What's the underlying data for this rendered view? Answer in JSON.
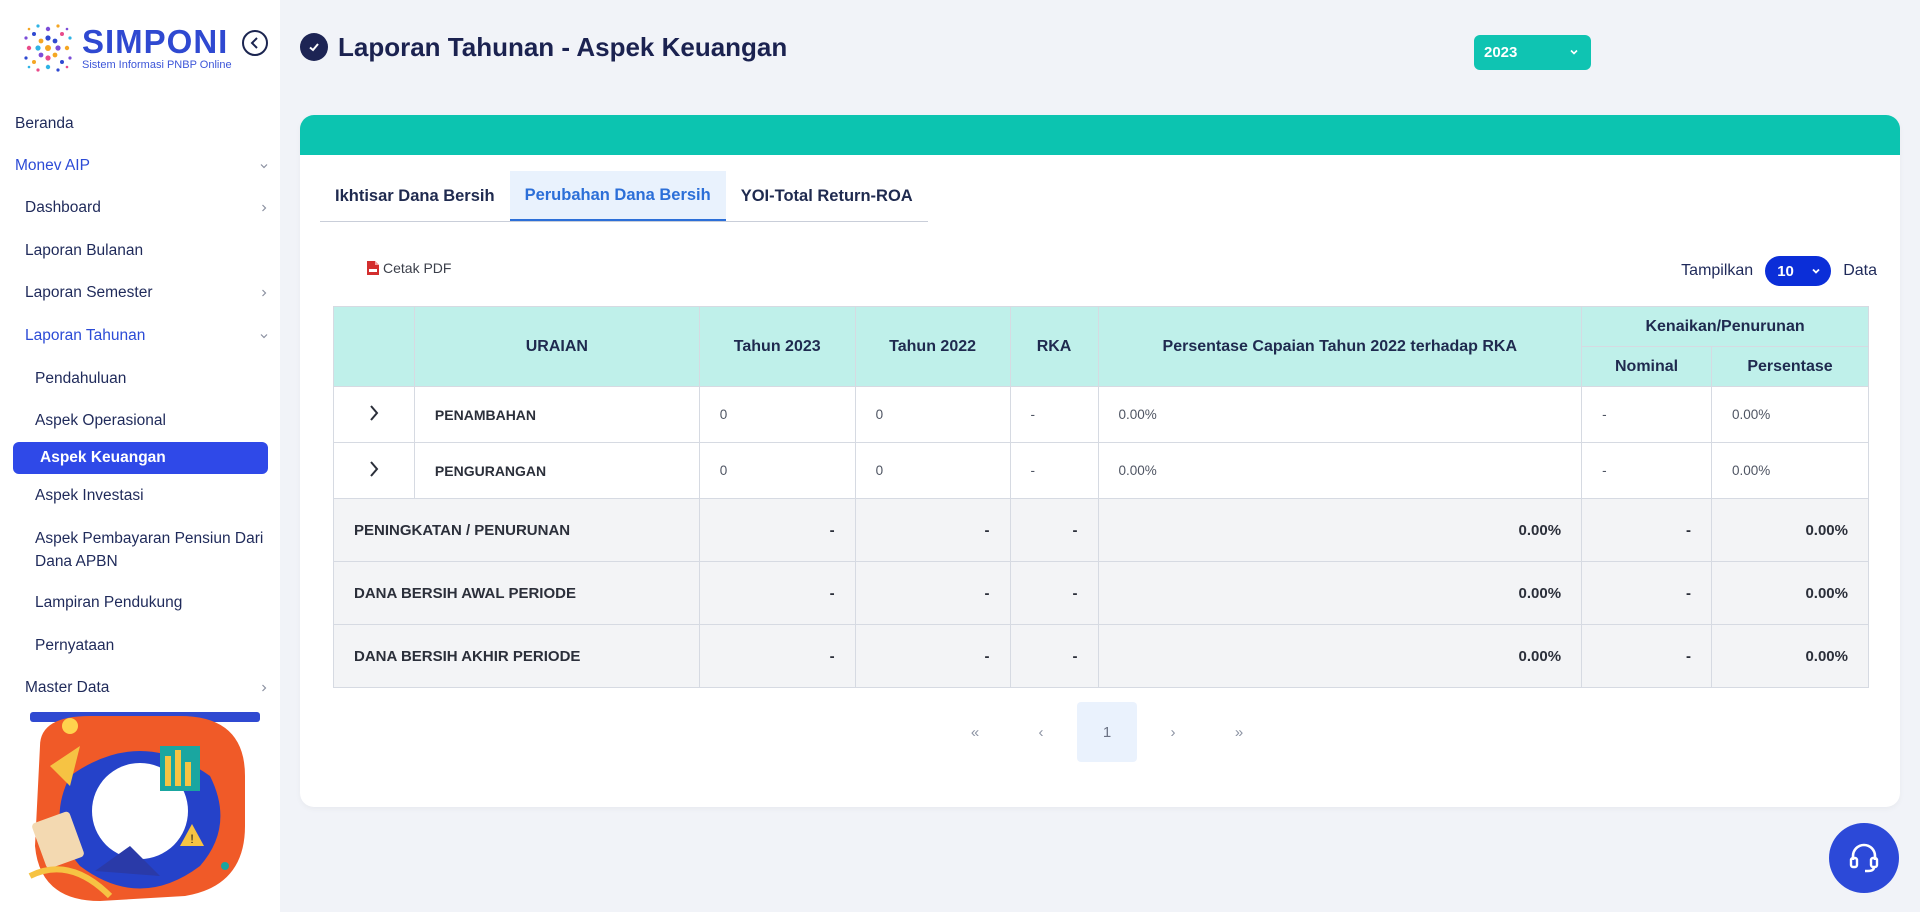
{
  "brand": {
    "title": "SIMPONI",
    "subtitle": "Sistem Informasi PNBP Online"
  },
  "sidebar": {
    "items": [
      {
        "label": "Beranda"
      },
      {
        "label": "Monev AIP"
      },
      {
        "label": "Dashboard"
      },
      {
        "label": "Laporan Bulanan"
      },
      {
        "label": "Laporan Semester"
      },
      {
        "label": "Laporan Tahunan"
      },
      {
        "label": "Pendahuluan"
      },
      {
        "label": "Aspek Operasional"
      },
      {
        "label": "Aspek Keuangan"
      },
      {
        "label": "Aspek Investasi"
      },
      {
        "label": "Aspek Pembayaran Pensiun Dari Dana APBN"
      },
      {
        "label": "Lampiran Pendukung"
      },
      {
        "label": "Pernyataan"
      },
      {
        "label": "Master Data"
      }
    ]
  },
  "header": {
    "title": "Laporan Tahunan - Aspek Keuangan",
    "year": "2023"
  },
  "tabs": [
    {
      "label": "Ikhtisar Dana Bersih"
    },
    {
      "label": "Perubahan Dana Bersih"
    },
    {
      "label": "YOI-Total Return-ROA"
    }
  ],
  "toolbar": {
    "pdf_label": "Cetak PDF",
    "show_label": "Tampilkan",
    "page_size": "10",
    "data_label": "Data"
  },
  "table": {
    "headers": {
      "uraian": "URAIAN",
      "tahun1": "Tahun 2023",
      "tahun2": "Tahun 2022",
      "rka": "RKA",
      "persentase_capaian": "Persentase Capaian Tahun 2022 terhadap RKA",
      "kenaikan": "Kenaikan/Penurunan",
      "nominal": "Nominal",
      "persentase": "Persentase"
    },
    "rows": [
      {
        "label": "PENAMBAHAN",
        "t2023": "0",
        "t2022": "0",
        "rka": "-",
        "capaian": "0.00%",
        "nominal": "-",
        "persen": "0.00%"
      },
      {
        "label": "PENGURANGAN",
        "t2023": "0",
        "t2022": "0",
        "rka": "-",
        "capaian": "0.00%",
        "nominal": "-",
        "persen": "0.00%"
      }
    ],
    "summary": [
      {
        "label": "PENINGKATAN / PENURUNAN",
        "t2023": "-",
        "t2022": "-",
        "rka": "-",
        "capaian": "0.00%",
        "nominal": "-",
        "persen": "0.00%"
      },
      {
        "label": "DANA BERSIH AWAL PERIODE",
        "t2023": "-",
        "t2022": "-",
        "rka": "-",
        "capaian": "0.00%",
        "nominal": "-",
        "persen": "0.00%"
      },
      {
        "label": "DANA BERSIH AKHIR PERIODE",
        "t2023": "-",
        "t2022": "-",
        "rka": "-",
        "capaian": "0.00%",
        "nominal": "-",
        "persen": "0.00%"
      }
    ]
  },
  "pagination": {
    "first": "«",
    "prev": "‹",
    "current": "1",
    "next": "›",
    "last": "»"
  },
  "colors": {
    "brand_blue": "#2f49d1",
    "teal": "#0cc4b0",
    "header_teal": "#bff0ea",
    "active_blue": "#2f49e8"
  }
}
